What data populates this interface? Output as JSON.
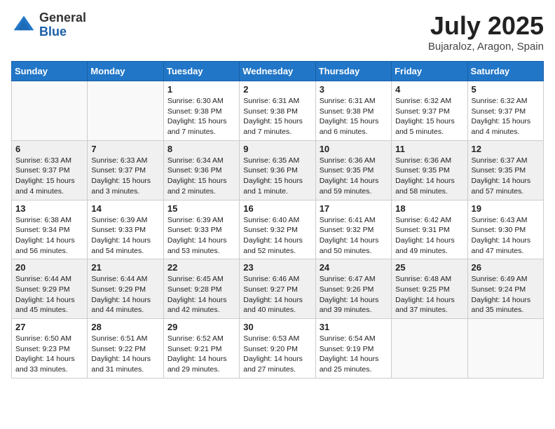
{
  "header": {
    "logo_general": "General",
    "logo_blue": "Blue",
    "month_title": "July 2025",
    "location": "Bujaraloz, Aragon, Spain"
  },
  "days_of_week": [
    "Sunday",
    "Monday",
    "Tuesday",
    "Wednesday",
    "Thursday",
    "Friday",
    "Saturday"
  ],
  "weeks": [
    [
      {
        "day": "",
        "content": ""
      },
      {
        "day": "",
        "content": ""
      },
      {
        "day": "1",
        "content": "Sunrise: 6:30 AM\nSunset: 9:38 PM\nDaylight: 15 hours and 7 minutes."
      },
      {
        "day": "2",
        "content": "Sunrise: 6:31 AM\nSunset: 9:38 PM\nDaylight: 15 hours and 7 minutes."
      },
      {
        "day": "3",
        "content": "Sunrise: 6:31 AM\nSunset: 9:38 PM\nDaylight: 15 hours and 6 minutes."
      },
      {
        "day": "4",
        "content": "Sunrise: 6:32 AM\nSunset: 9:37 PM\nDaylight: 15 hours and 5 minutes."
      },
      {
        "day": "5",
        "content": "Sunrise: 6:32 AM\nSunset: 9:37 PM\nDaylight: 15 hours and 4 minutes."
      }
    ],
    [
      {
        "day": "6",
        "content": "Sunrise: 6:33 AM\nSunset: 9:37 PM\nDaylight: 15 hours and 4 minutes."
      },
      {
        "day": "7",
        "content": "Sunrise: 6:33 AM\nSunset: 9:37 PM\nDaylight: 15 hours and 3 minutes."
      },
      {
        "day": "8",
        "content": "Sunrise: 6:34 AM\nSunset: 9:36 PM\nDaylight: 15 hours and 2 minutes."
      },
      {
        "day": "9",
        "content": "Sunrise: 6:35 AM\nSunset: 9:36 PM\nDaylight: 15 hours and 1 minute."
      },
      {
        "day": "10",
        "content": "Sunrise: 6:36 AM\nSunset: 9:35 PM\nDaylight: 14 hours and 59 minutes."
      },
      {
        "day": "11",
        "content": "Sunrise: 6:36 AM\nSunset: 9:35 PM\nDaylight: 14 hours and 58 minutes."
      },
      {
        "day": "12",
        "content": "Sunrise: 6:37 AM\nSunset: 9:35 PM\nDaylight: 14 hours and 57 minutes."
      }
    ],
    [
      {
        "day": "13",
        "content": "Sunrise: 6:38 AM\nSunset: 9:34 PM\nDaylight: 14 hours and 56 minutes."
      },
      {
        "day": "14",
        "content": "Sunrise: 6:39 AM\nSunset: 9:33 PM\nDaylight: 14 hours and 54 minutes."
      },
      {
        "day": "15",
        "content": "Sunrise: 6:39 AM\nSunset: 9:33 PM\nDaylight: 14 hours and 53 minutes."
      },
      {
        "day": "16",
        "content": "Sunrise: 6:40 AM\nSunset: 9:32 PM\nDaylight: 14 hours and 52 minutes."
      },
      {
        "day": "17",
        "content": "Sunrise: 6:41 AM\nSunset: 9:32 PM\nDaylight: 14 hours and 50 minutes."
      },
      {
        "day": "18",
        "content": "Sunrise: 6:42 AM\nSunset: 9:31 PM\nDaylight: 14 hours and 49 minutes."
      },
      {
        "day": "19",
        "content": "Sunrise: 6:43 AM\nSunset: 9:30 PM\nDaylight: 14 hours and 47 minutes."
      }
    ],
    [
      {
        "day": "20",
        "content": "Sunrise: 6:44 AM\nSunset: 9:29 PM\nDaylight: 14 hours and 45 minutes."
      },
      {
        "day": "21",
        "content": "Sunrise: 6:44 AM\nSunset: 9:29 PM\nDaylight: 14 hours and 44 minutes."
      },
      {
        "day": "22",
        "content": "Sunrise: 6:45 AM\nSunset: 9:28 PM\nDaylight: 14 hours and 42 minutes."
      },
      {
        "day": "23",
        "content": "Sunrise: 6:46 AM\nSunset: 9:27 PM\nDaylight: 14 hours and 40 minutes."
      },
      {
        "day": "24",
        "content": "Sunrise: 6:47 AM\nSunset: 9:26 PM\nDaylight: 14 hours and 39 minutes."
      },
      {
        "day": "25",
        "content": "Sunrise: 6:48 AM\nSunset: 9:25 PM\nDaylight: 14 hours and 37 minutes."
      },
      {
        "day": "26",
        "content": "Sunrise: 6:49 AM\nSunset: 9:24 PM\nDaylight: 14 hours and 35 minutes."
      }
    ],
    [
      {
        "day": "27",
        "content": "Sunrise: 6:50 AM\nSunset: 9:23 PM\nDaylight: 14 hours and 33 minutes."
      },
      {
        "day": "28",
        "content": "Sunrise: 6:51 AM\nSunset: 9:22 PM\nDaylight: 14 hours and 31 minutes."
      },
      {
        "day": "29",
        "content": "Sunrise: 6:52 AM\nSunset: 9:21 PM\nDaylight: 14 hours and 29 minutes."
      },
      {
        "day": "30",
        "content": "Sunrise: 6:53 AM\nSunset: 9:20 PM\nDaylight: 14 hours and 27 minutes."
      },
      {
        "day": "31",
        "content": "Sunrise: 6:54 AM\nSunset: 9:19 PM\nDaylight: 14 hours and 25 minutes."
      },
      {
        "day": "",
        "content": ""
      },
      {
        "day": "",
        "content": ""
      }
    ]
  ]
}
